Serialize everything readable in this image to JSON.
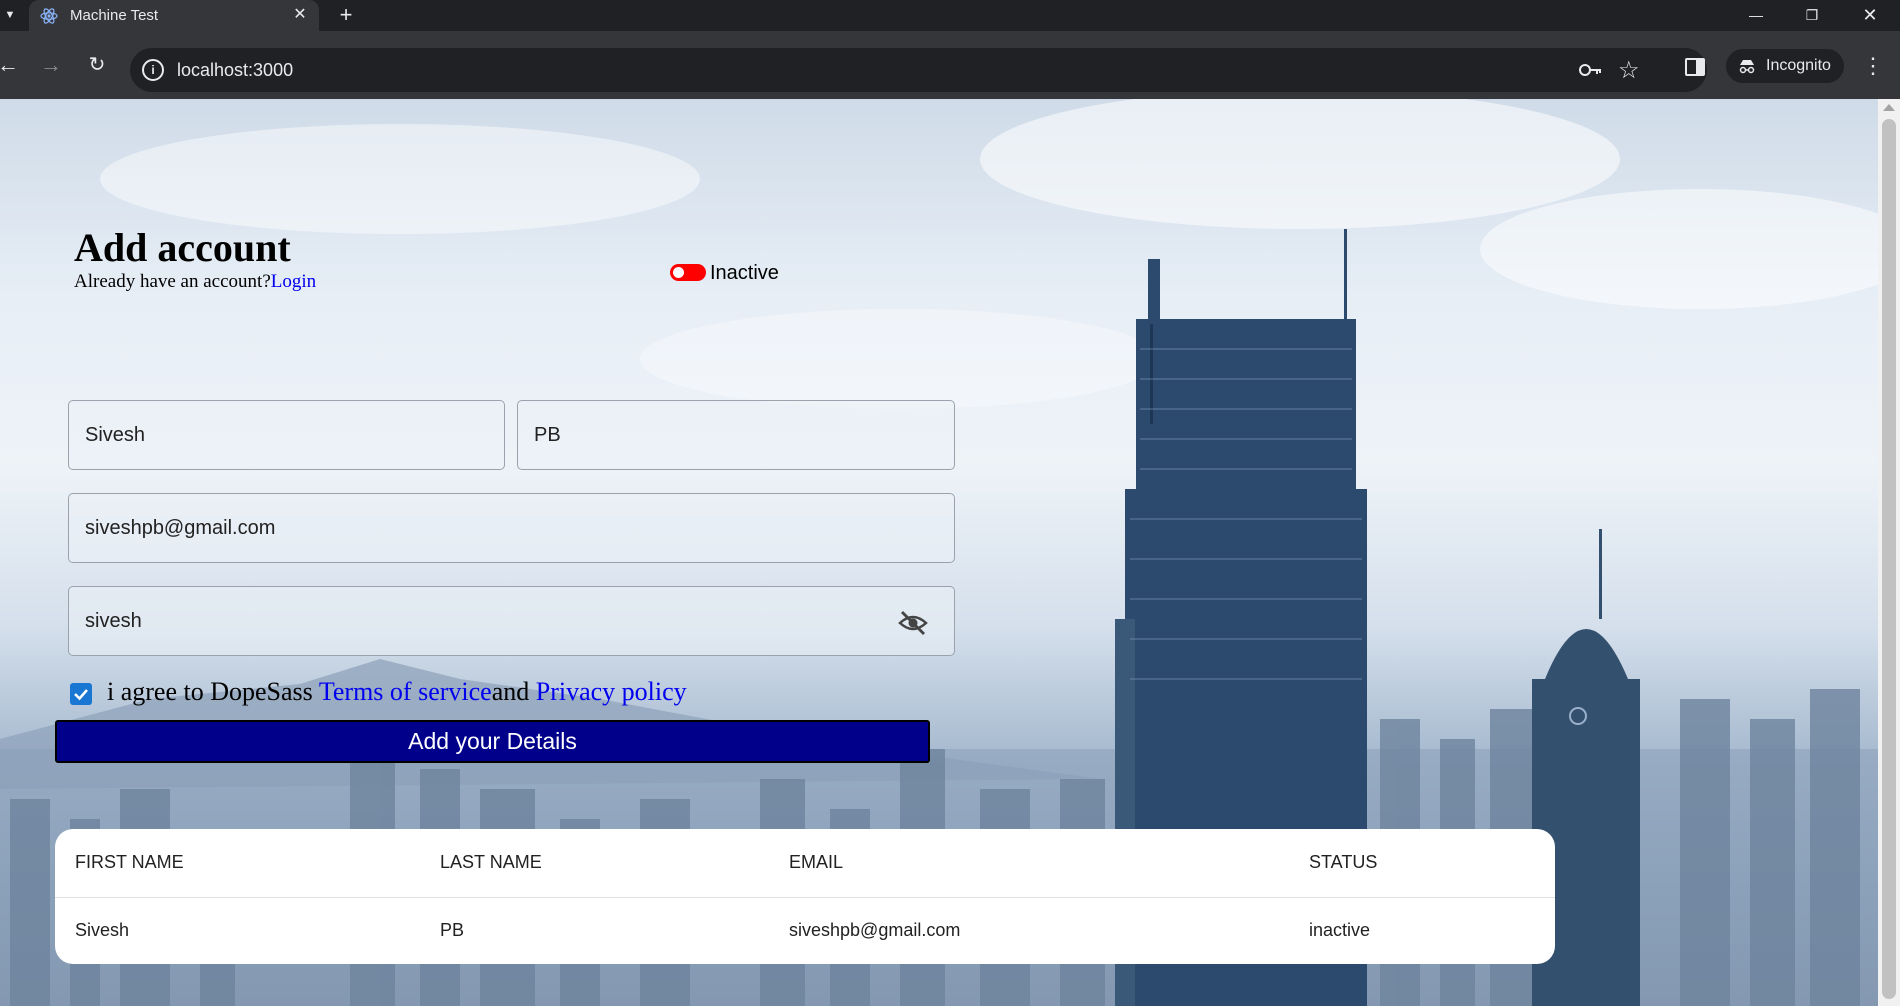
{
  "browser": {
    "tab_title": "Machine Test",
    "url": "localhost:3000",
    "incognito_label": "Incognito"
  },
  "page": {
    "title": "Add account",
    "subtitle_text": "Already have an account?",
    "login_link": "Login",
    "status_label": "Inactive",
    "status_active": false,
    "status_color": "#ff0000"
  },
  "form": {
    "first_name": "Sivesh",
    "last_name": "PB",
    "email": "siveshpb@gmail.com",
    "password": "sivesh",
    "password_visibility_icon": "eye-off-icon",
    "agree_checked": true,
    "agree_prefix": "i agree to DopeSass ",
    "terms_link": "Terms of service",
    "agree_middle": "and ",
    "privacy_link": "Privacy policy",
    "submit_label": "Add your Details",
    "submit_color": "#00008b",
    "checkbox_color": "#1976d2"
  },
  "table": {
    "headers": [
      "FIRST NAME",
      "LAST NAME",
      "EMAIL",
      "STATUS"
    ],
    "rows": [
      [
        "Sivesh",
        "PB",
        "siveshpb@gmail.com",
        "inactive"
      ]
    ]
  }
}
